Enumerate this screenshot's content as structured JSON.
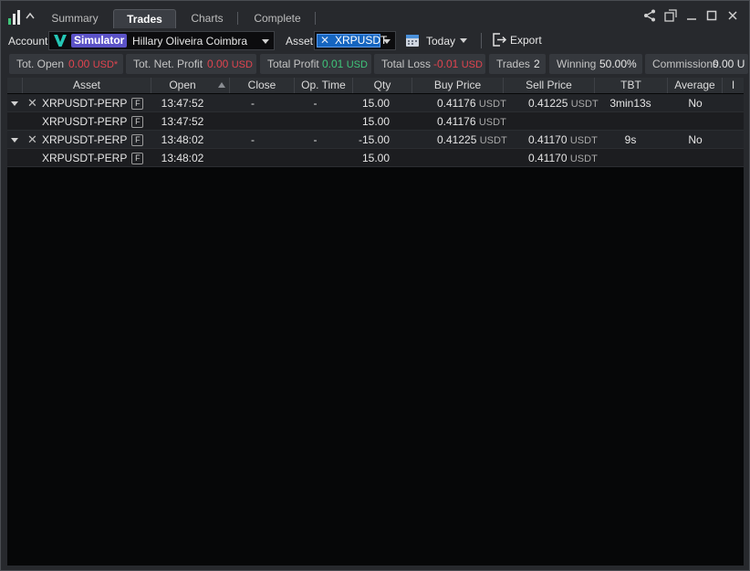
{
  "tabs": [
    {
      "label": "Summary"
    },
    {
      "label": "Trades"
    },
    {
      "label": "Charts"
    },
    {
      "label": "Complete"
    }
  ],
  "toolbar": {
    "account_label": "Account",
    "account_badge": "Simulator",
    "account_name": "Hillary Oliveira Coimbra",
    "asset_label": "Asset",
    "asset_value": "XRPUSDT",
    "period": "Today",
    "export_label": "Export"
  },
  "stats": {
    "tot_open": {
      "label": "Tot. Open",
      "value": "0.00",
      "unit": "USD*"
    },
    "net_profit": {
      "label": "Tot. Net. Profit",
      "value": "0.00",
      "unit": "USD"
    },
    "total_profit": {
      "label": "Total Profit",
      "value": "0.01",
      "unit": "USD"
    },
    "total_loss": {
      "label": "Total Loss",
      "value": "-0.01",
      "unit": "USD"
    },
    "trades": {
      "label": "Trades",
      "value": "2"
    },
    "winning": {
      "label": "Winning",
      "value": "50.00%"
    },
    "commissions": {
      "label": "Commissions",
      "value": "0.00 U"
    }
  },
  "table": {
    "columns": [
      "Asset",
      "Open",
      "Close",
      "Op. Time",
      "Qty",
      "Buy Price",
      "Sell Price",
      "TBT",
      "Average",
      "I"
    ],
    "rows": [
      {
        "asset": "XRPUSDT-PERP",
        "badge": "F",
        "open": "13:47:52",
        "close": "-",
        "op_time": "-",
        "qty": "15.00",
        "buy_price": "0.41176",
        "buy_unit": "USDT",
        "sell_price": "0.41225",
        "sell_unit": "USDT",
        "tbt": "3min13s",
        "average": "No"
      },
      {
        "asset": "XRPUSDT-PERP",
        "badge": "F",
        "open": "13:47:52",
        "qty": "15.00",
        "buy_price": "0.41176",
        "buy_unit": "USDT"
      },
      {
        "asset": "XRPUSDT-PERP",
        "badge": "F",
        "open": "13:48:02",
        "close": "-",
        "op_time": "-",
        "qty": "-15.00",
        "buy_price": "0.41225",
        "buy_unit": "USDT",
        "sell_price": "0.41170",
        "sell_unit": "USDT",
        "tbt": "9s",
        "average": "No"
      },
      {
        "asset": "XRPUSDT-PERP",
        "badge": "F",
        "open": "13:48:02",
        "qty": "15.00",
        "sell_price": "0.41170",
        "sell_unit": "USDT"
      }
    ]
  },
  "colors": {
    "accent": "#1565c0",
    "simulator_badge": "#5b52c7",
    "profit": "#3fc57a",
    "loss": "#e0444f",
    "background": "#27292d",
    "grid_background": "#060708"
  },
  "icons": [
    "app-logo-icon",
    "share-icon",
    "popout-icon",
    "minimize-icon",
    "maximize-icon",
    "close-icon",
    "calendar-icon",
    "export-icon",
    "expand-caret-icon",
    "remove-x-icon"
  ]
}
